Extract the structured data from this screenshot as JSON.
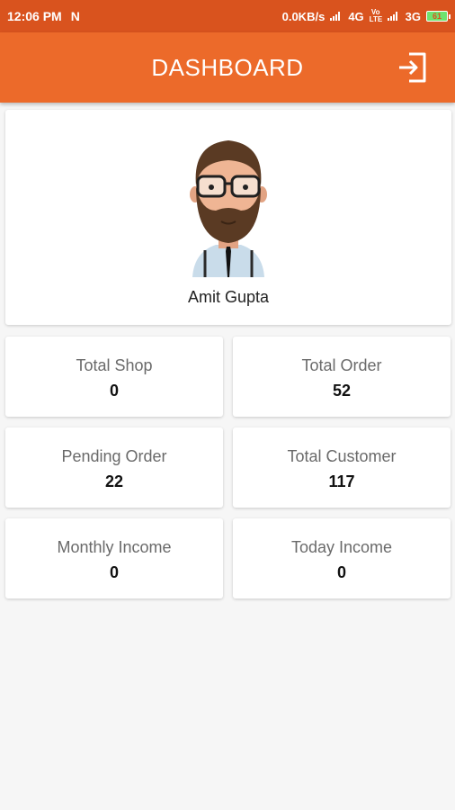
{
  "status_bar": {
    "time": "12:06 PM",
    "notif_icon": "N",
    "network_speed": "0.0KB/s",
    "net1": "4G",
    "volte": "Vo LTE",
    "net2": "3G",
    "battery": "61"
  },
  "app_bar": {
    "title": "DASHBOARD",
    "logout_icon": "logout-icon"
  },
  "profile": {
    "name": "Amit Gupta",
    "avatar_icon": "bearded-man-avatar"
  },
  "stats": [
    {
      "label": "Total Shop",
      "value": "0"
    },
    {
      "label": "Total Order",
      "value": "52"
    },
    {
      "label": "Pending Order",
      "value": "22"
    },
    {
      "label": "Total Customer",
      "value": "117"
    },
    {
      "label": "Monthly Income",
      "value": "0"
    },
    {
      "label": "Today Income",
      "value": "0"
    }
  ],
  "colors": {
    "status_bar": "#d9531e",
    "app_bar": "#ec6a2a",
    "background": "#f6f6f6"
  }
}
